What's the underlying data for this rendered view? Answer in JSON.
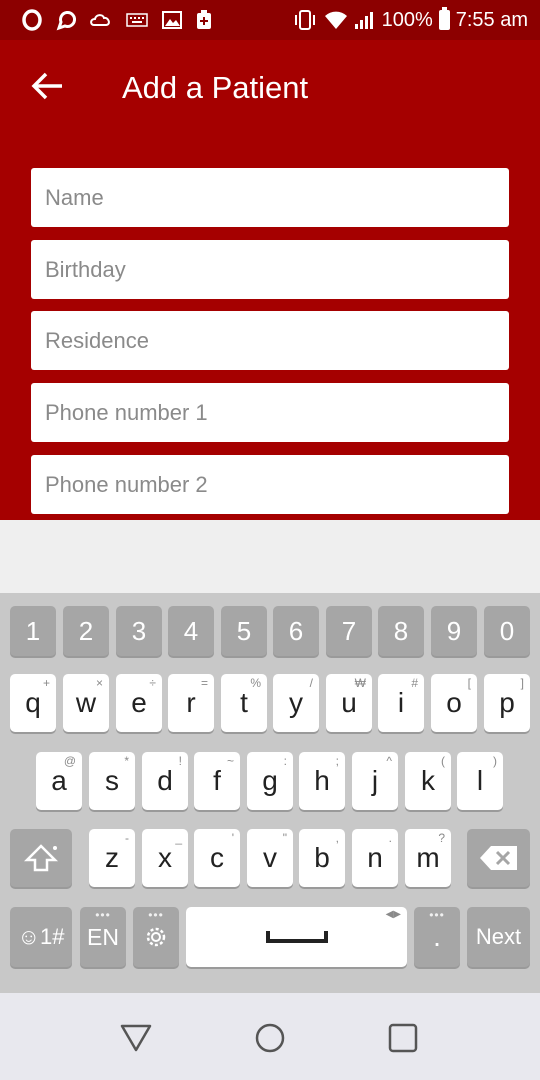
{
  "status_bar": {
    "battery": "100%",
    "time": "7:55 am",
    "left_icons": [
      "opera-icon",
      "chat-bubble-icon",
      "cloud-icon",
      "keyboard-icon",
      "image-icon",
      "medical-icon"
    ],
    "right_icons": [
      "vibrate-icon",
      "wifi-icon",
      "signal-icon",
      "battery-icon"
    ]
  },
  "app_bar": {
    "title": "Add a Patient",
    "back_icon": "arrow-left-icon",
    "color": "#a50000"
  },
  "form": {
    "fields": [
      {
        "placeholder": "Name",
        "value": ""
      },
      {
        "placeholder": "Birthday",
        "value": ""
      },
      {
        "placeholder": "Residence",
        "value": ""
      },
      {
        "placeholder": "Phone number 1",
        "value": ""
      },
      {
        "placeholder": "Phone number 2",
        "value": ""
      }
    ]
  },
  "keyboard": {
    "number_row": [
      "1",
      "2",
      "3",
      "4",
      "5",
      "6",
      "7",
      "8",
      "9",
      "0"
    ],
    "row1": [
      {
        "key": "q",
        "hint": "+"
      },
      {
        "key": "w",
        "hint": "×"
      },
      {
        "key": "e",
        "hint": "÷"
      },
      {
        "key": "r",
        "hint": "="
      },
      {
        "key": "t",
        "hint": "%"
      },
      {
        "key": "y",
        "hint": "/"
      },
      {
        "key": "u",
        "hint": "₩"
      },
      {
        "key": "i",
        "hint": "#"
      },
      {
        "key": "o",
        "hint": "["
      },
      {
        "key": "p",
        "hint": "]"
      }
    ],
    "row2": [
      {
        "key": "a",
        "hint": "@"
      },
      {
        "key": "s",
        "hint": "*"
      },
      {
        "key": "d",
        "hint": "!"
      },
      {
        "key": "f",
        "hint": "~"
      },
      {
        "key": "g",
        "hint": ":"
      },
      {
        "key": "h",
        "hint": ";"
      },
      {
        "key": "j",
        "hint": "^"
      },
      {
        "key": "k",
        "hint": "("
      },
      {
        "key": "l",
        "hint": ")"
      }
    ],
    "row3": [
      {
        "key": "z",
        "hint": "-"
      },
      {
        "key": "x",
        "hint": "_"
      },
      {
        "key": "c",
        "hint": "'"
      },
      {
        "key": "v",
        "hint": "\""
      },
      {
        "key": "b",
        "hint": ","
      },
      {
        "key": "n",
        "hint": "."
      },
      {
        "key": "m",
        "hint": "?"
      }
    ],
    "symbols_label": "☺1#",
    "language_label": "EN",
    "action_label": "Next",
    "period_label": ".",
    "shift_icon": "shift-icon",
    "backspace_icon": "backspace-icon",
    "settings_icon": "gear-icon",
    "space_icon": "spacebar-icon"
  },
  "nav_bar": {
    "back_icon": "triangle-back-icon",
    "home_icon": "circle-home-icon",
    "recents_icon": "square-recents-icon"
  }
}
